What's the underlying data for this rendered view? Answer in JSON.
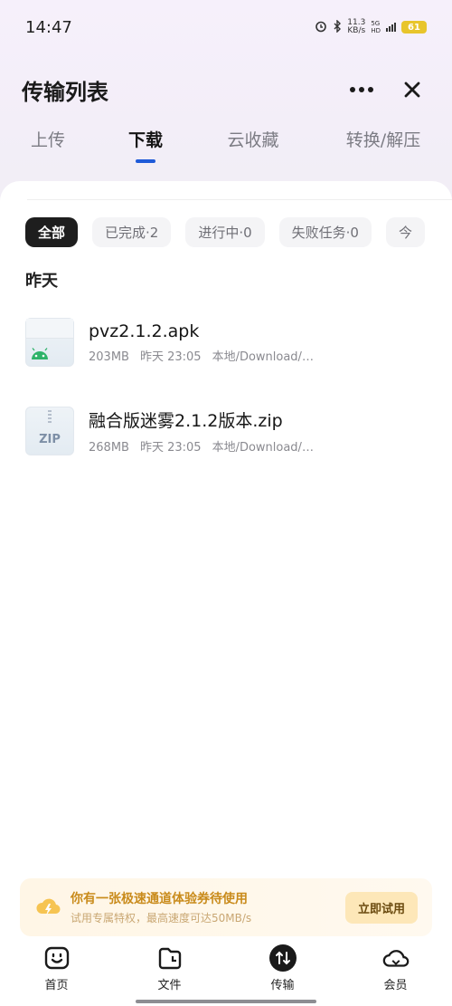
{
  "status_bar": {
    "time": "14:47",
    "speed_value": "11.3",
    "speed_unit": "KB/s",
    "network_5g": "5G",
    "network_hd": "HD",
    "battery": "61"
  },
  "header": {
    "title": "传输列表"
  },
  "tabs": [
    {
      "label": "上传"
    },
    {
      "label": "下载"
    },
    {
      "label": "云收藏"
    },
    {
      "label": "转换/解压"
    }
  ],
  "filters": [
    {
      "label": "全部"
    },
    {
      "label": "已完成·2"
    },
    {
      "label": "进行中·0"
    },
    {
      "label": "失败任务·0"
    },
    {
      "label": "今"
    }
  ],
  "section": {
    "title": "昨天"
  },
  "files": [
    {
      "name": "pvz2.1.2.apk",
      "size": "203MB",
      "time": "昨天 23:05",
      "path": "本地/Download/…",
      "icon": "android-apk-file-icon"
    },
    {
      "name": "融合版迷雾2.1.2版本.zip",
      "size": "268MB",
      "time": "昨天 23:05",
      "path": "本地/Download/…",
      "icon": "zip-file-icon",
      "icon_label": "ZIP"
    }
  ],
  "promo": {
    "title": "你有一张极速通道体验券待使用",
    "subtitle": "试用专属特权，最高速度可达50MB/s",
    "button": "立即试用"
  },
  "bottom_nav": [
    {
      "label": "首页",
      "icon": "smiley-box-icon"
    },
    {
      "label": "文件",
      "icon": "folder-icon"
    },
    {
      "label": "传输",
      "icon": "transfer-arrows-icon"
    },
    {
      "label": "会员",
      "icon": "cloud-icon"
    }
  ],
  "colors": {
    "accent": "#1f5bd8",
    "promo_title": "#c98b1b",
    "chip_active": "#1e1e1e"
  }
}
